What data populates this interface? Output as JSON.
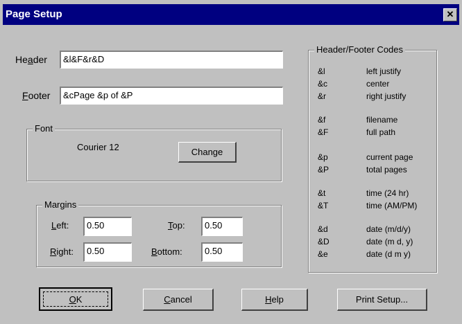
{
  "window": {
    "title": "Page Setup",
    "close_glyph": "✕"
  },
  "header_field": {
    "label_pre": "He",
    "label_key": "a",
    "label_post": "der",
    "value": "&l&F&r&D"
  },
  "footer_field": {
    "label_pre": "",
    "label_key": "F",
    "label_post": "ooter",
    "value": "&cPage &p of &P"
  },
  "font_group": {
    "title": "Font",
    "current_font": "Courier 12",
    "change_label": "Change"
  },
  "margins_group": {
    "title": "Margins",
    "left": {
      "label_pre": "",
      "label_key": "L",
      "label_post": "eft:",
      "value": "0.50"
    },
    "top": {
      "label_pre": "",
      "label_key": "T",
      "label_post": "op:",
      "value": "0.50"
    },
    "right": {
      "label_pre": "",
      "label_key": "R",
      "label_post": "ight:",
      "value": "0.50"
    },
    "bottom": {
      "label_pre": "",
      "label_key": "B",
      "label_post": "ottom:",
      "value": "0.50"
    }
  },
  "codes_group": {
    "title": "Header/Footer Codes",
    "codes": [
      {
        "symbol": "&l",
        "desc": "left justify"
      },
      {
        "symbol": "&c",
        "desc": "center"
      },
      {
        "symbol": "&r",
        "desc": "right justify"
      },
      {
        "symbol": "&f",
        "desc": "filename"
      },
      {
        "symbol": "&F",
        "desc": "full path"
      },
      {
        "symbol": "&p",
        "desc": "current page"
      },
      {
        "symbol": "&P",
        "desc": "total pages"
      },
      {
        "symbol": "&t",
        "desc": "time (24 hr)"
      },
      {
        "symbol": "&T",
        "desc": "time (AM/PM)"
      },
      {
        "symbol": "&d",
        "desc": "date (m/d/y)"
      },
      {
        "symbol": "&D",
        "desc": "date (m d, y)"
      },
      {
        "symbol": "&e",
        "desc": "date (d m y)"
      }
    ]
  },
  "buttons": {
    "ok": {
      "label_pre": "",
      "label_key": "O",
      "label_post": "K"
    },
    "cancel": {
      "label_pre": "",
      "label_key": "C",
      "label_post": "ancel"
    },
    "help": {
      "label_pre": "",
      "label_key": "H",
      "label_post": "elp"
    },
    "print_setup": {
      "label": "Print Setup..."
    }
  },
  "colors": {
    "face": "#c0c0c0",
    "titlebar": "#000080",
    "field_bg": "#ffffff"
  }
}
